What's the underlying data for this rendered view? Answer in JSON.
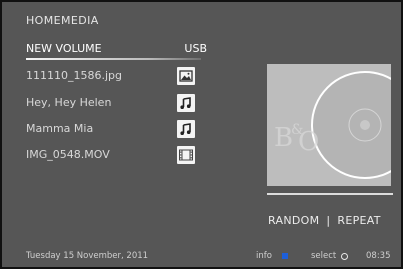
{
  "header": {
    "title": "HOMEMEDIA"
  },
  "volume": {
    "label": "NEW VOLUME",
    "source": "USB"
  },
  "files": [
    {
      "name": "111110_1586.jpg",
      "icon": "image-icon"
    },
    {
      "name": "Hey, Hey Helen",
      "icon": "music-note-icon"
    },
    {
      "name": "Mamma Mia",
      "icon": "music-note-icon"
    },
    {
      "name": "IMG_0548.MOV",
      "icon": "film-icon"
    }
  ],
  "playback": {
    "random_label": "RANDOM",
    "separator": "|",
    "repeat_label": "REPEAT"
  },
  "footer": {
    "date": "Tuesday 15 November, 2011",
    "info_label": "info",
    "select_label": "select",
    "time": "08:35"
  },
  "colors": {
    "background": "#565656",
    "info_indicator": "#1e5fd8",
    "album_art": "#bdbdbd"
  }
}
